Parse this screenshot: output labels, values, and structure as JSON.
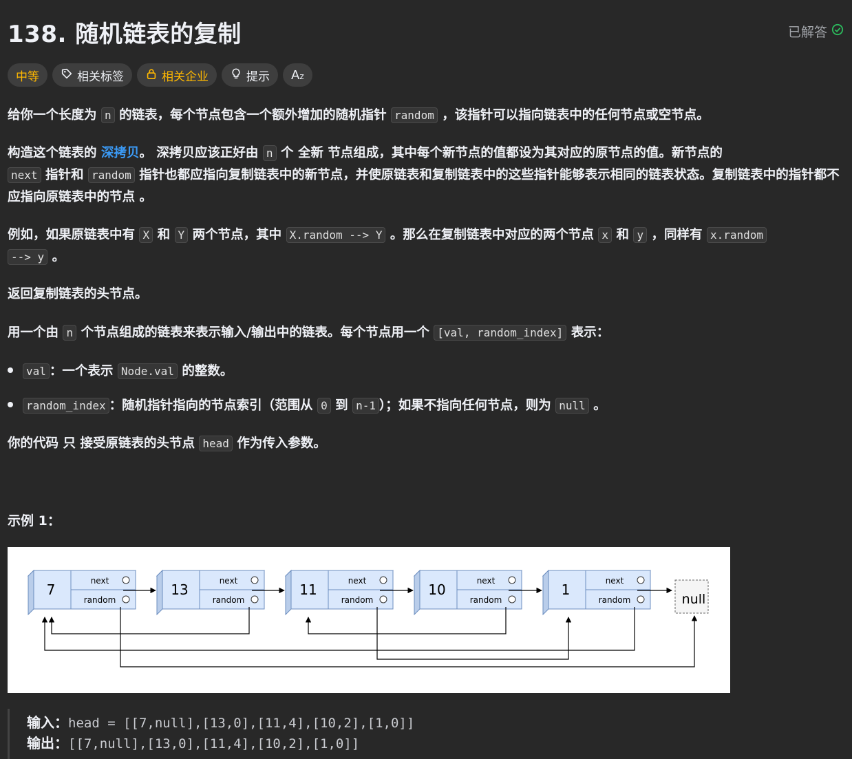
{
  "problem": {
    "title": "138. 随机链表的复制",
    "status": "已解答"
  },
  "tags": {
    "difficulty": "中等",
    "related_tags": "相关标签",
    "related_companies": "相关企业",
    "hint": "提示",
    "font_size": "A"
  },
  "description": {
    "p1_a": "给你一个长度为",
    "p1_code1": "n",
    "p1_b": "的链表，每个节点包含一个额外增加的随机指针",
    "p1_code2": "random",
    "p1_c": "，该指针可以指向链表中的任何节点或空节点。",
    "p2_a": "构造这个链表的",
    "p2_link": "深拷贝",
    "p2_b": "。 深拷贝应该正好由",
    "p2_code1": "n",
    "p2_c": "个",
    "p2_bold": "全新",
    "p2_d": "节点组成，其中每个新节点的值都设为其对应的原节点的值。新节点的",
    "p2_code2": "next",
    "p2_e": "指针和",
    "p2_code3": "random",
    "p2_f": "指针也都应指向复制链表中的新节点，并使原链表和复制链表中的这些指针能够表示相同的链表状态。",
    "p2_bold2": "复制链表中的指针都不应指向原链表中的节点",
    "p2_g": "。",
    "p3_a": "例如，如果原链表中有",
    "p3_code1": "X",
    "p3_b": "和",
    "p3_code2": "Y",
    "p3_c": "两个节点，其中",
    "p3_code3": "X.random --> Y",
    "p3_d": "。那么在复制链表中对应的两个节点",
    "p3_code4": "x",
    "p3_e": "和",
    "p3_code5": "y",
    "p3_f": "，同样有",
    "p3_code6": "x.random",
    "p3_code7": "--> y",
    "p3_g": "。",
    "p4": "返回复制链表的头节点。",
    "p5_a": "用一个由",
    "p5_code1": "n",
    "p5_b": "个节点组成的链表来表示输入/输出中的链表。每个节点用一个",
    "p5_code2": "[val, random_index]",
    "p5_c": "表示：",
    "b1_code1": "val",
    "b1_a": "：一个表示",
    "b1_code2": "Node.val",
    "b1_b": "的整数。",
    "b2_code1": "random_index",
    "b2_a": "：随机指针指向的节点索引（范围从",
    "b2_code2": "0",
    "b2_b": "到",
    "b2_code3": "n-1",
    "b2_c": "）；如果不指向任何节点，则为",
    "b2_code4": "null",
    "b2_d": "。",
    "p6_a": "你的代码",
    "p6_bold": "只",
    "p6_b": "接受原链表的头节点",
    "p6_code": "head",
    "p6_c": "作为传入参数。"
  },
  "example1": {
    "title": "示例 1：",
    "input_label": "输入：",
    "input_value": "head = [[7,null],[13,0],[11,4],[10,2],[1,0]]",
    "output_label": "输出：",
    "output_value": "[[7,null],[13,0],[11,4],[10,2],[1,0]]"
  },
  "diagram": {
    "nodes": [
      "7",
      "13",
      "11",
      "10",
      "1"
    ],
    "next_label": "next",
    "random_label": "random",
    "null_label": "null"
  },
  "colors": {
    "bg": "#282828",
    "difficulty": "#ffb800",
    "link": "#3b9af5",
    "solved_check": "#2cbb5d",
    "node_fill": "#dae8fc",
    "node_stroke": "#6c8ebf"
  }
}
